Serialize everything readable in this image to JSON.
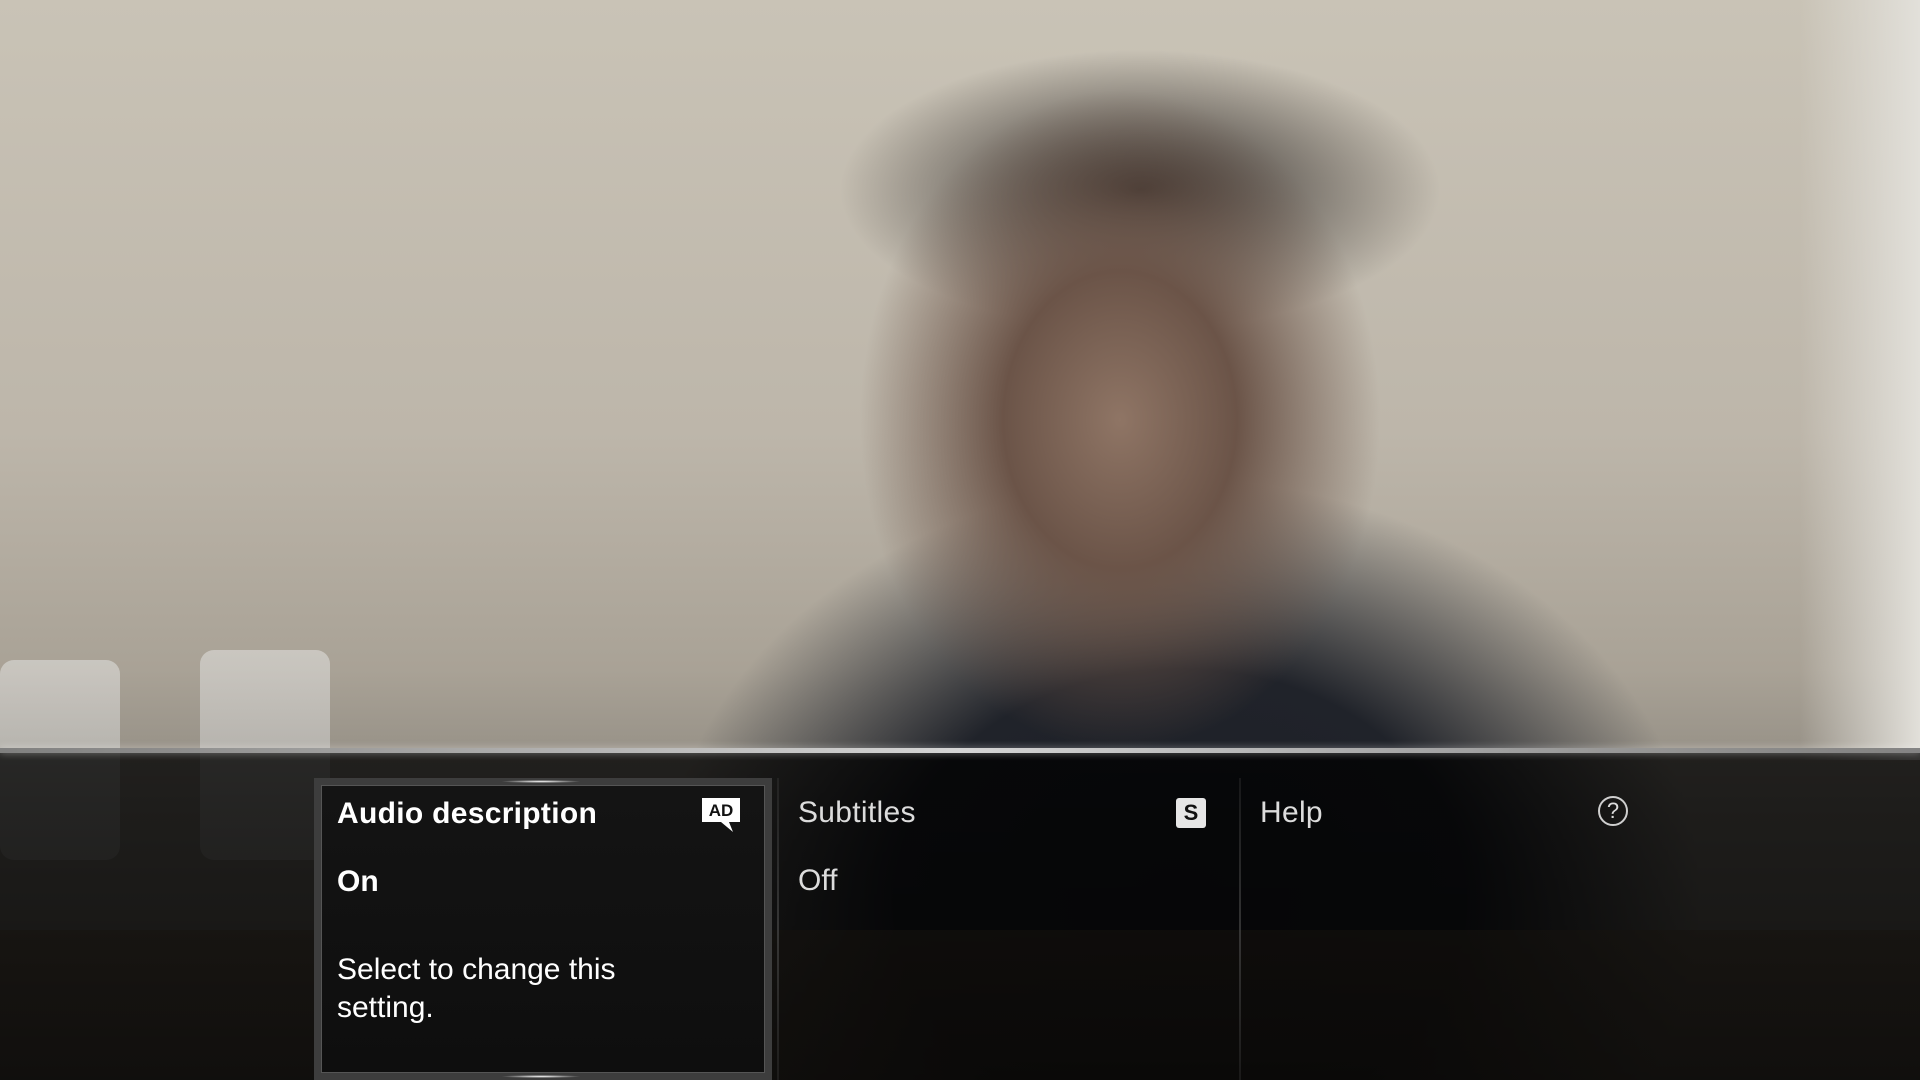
{
  "osd_menu": {
    "audio_description": {
      "title": "Audio description",
      "value": "On",
      "description": "Select to change this setting.",
      "icon": "ad-icon",
      "icon_text": "AD"
    },
    "subtitles": {
      "title": "Subtitles",
      "value": "Off",
      "icon": "subtitles-icon",
      "icon_text": "S"
    },
    "help": {
      "title": "Help",
      "icon": "help-icon",
      "icon_text": "?"
    }
  },
  "colors": {
    "selected_border": "#3d3d3d",
    "panel_background": "#0e0e0e",
    "text": "#ffffff"
  }
}
